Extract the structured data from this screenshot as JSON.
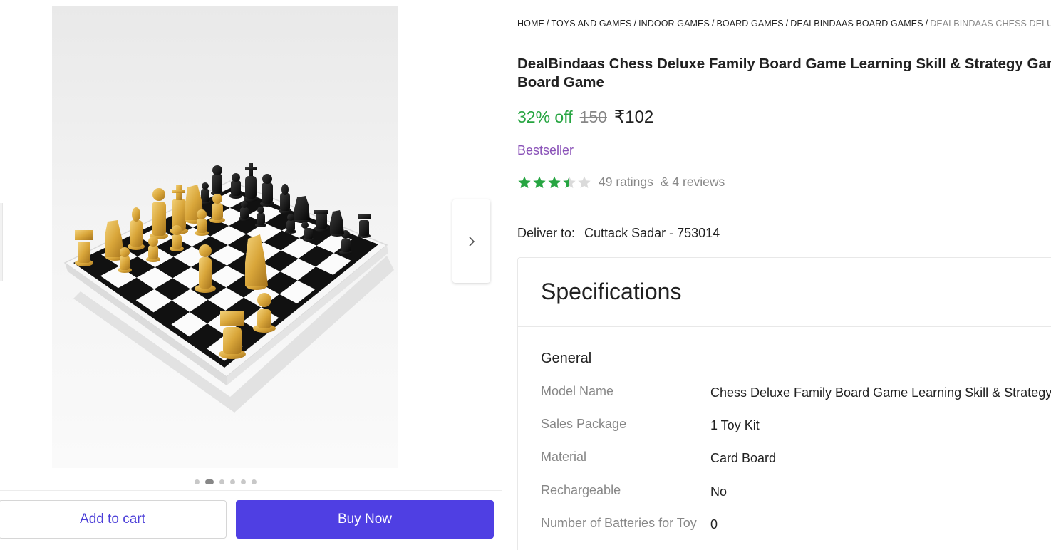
{
  "gallery": {
    "image_alt": "DealBindaas Chess Deluxe chess board with gold and black pieces",
    "dots": [
      false,
      true,
      false,
      false,
      false,
      false
    ],
    "next_icon": "chevron-right-icon"
  },
  "actions": {
    "add_to_cart": "Add to cart",
    "buy_now": "Buy Now"
  },
  "breadcrumb": {
    "items": [
      "HOME",
      "TOYS AND GAMES",
      "INDOOR GAMES",
      "BOARD GAMES",
      "DEALBINDAAS BOARD GAMES",
      "DEALBINDAAS CHESS DELUXE FAMILY BOARD GAME LEARNING SKILL & STRATEGY GAME BOARD GAME"
    ],
    "separator": "/"
  },
  "product": {
    "title_line1": "DealBindaas Chess Deluxe Family Board Game Learning Skill & Strategy Game",
    "title_line2": "Board Game",
    "discount": "32% off",
    "mrp": "150",
    "price": "₹102",
    "badge": "Bestseller",
    "rating_value": 3.5,
    "ratings_text": "49 ratings",
    "reviews_text": "& 4 reviews",
    "colors": {
      "discount": "#26a541",
      "star": "#26a541",
      "badge": "#8a52b8",
      "buy_button": "#4f3fe3"
    }
  },
  "delivery": {
    "label": "Deliver to:",
    "location": "Cuttack Sadar - 753014"
  },
  "specifications": {
    "title": "Specifications",
    "group": "General",
    "rows": [
      {
        "key": "Model Name",
        "value": "Chess Deluxe Family Board Game Learning Skill & Strategy Game"
      },
      {
        "key": "Sales Package",
        "value": "1 Toy Kit"
      },
      {
        "key": "Material",
        "value": "Card Board"
      },
      {
        "key": "Rechargeable",
        "value": "No"
      },
      {
        "key": "Number of Batteries for Toy",
        "value": "0"
      }
    ]
  }
}
